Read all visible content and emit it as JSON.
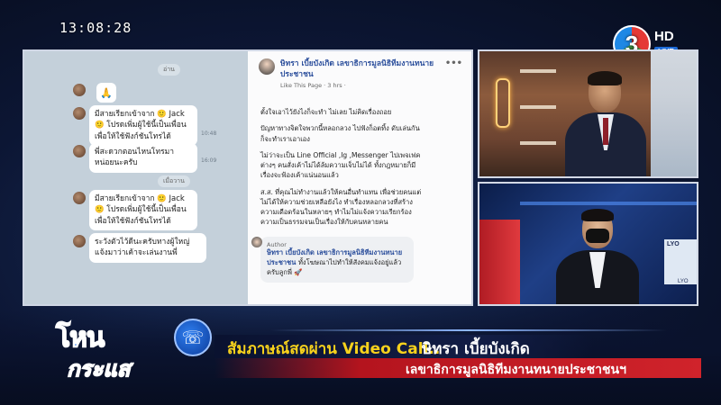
{
  "clock": "13:08:28",
  "channel": {
    "number": "3",
    "hd": "HD",
    "live": "LIVE"
  },
  "chat": {
    "top_label": "อ่าน",
    "separator": "เมื่อวาน",
    "messages": [
      {
        "text": "🙏",
        "time": ""
      },
      {
        "text": "มีสายเรียกเข้าจาก 🙂 Jack 🙂 โปรดเพิ่มผู้ใช้นี้เป็นเพื่อนเพื่อให้ใช้ฟังก์ชันโทรได้",
        "time": "10:48"
      },
      {
        "text": "พี่สะดวกตอนไหนโทรมาหน่อยนะครับ",
        "time": "16:09"
      },
      {
        "text": "มีสายเรียกเข้าจาก 🙂 Jack 🙂 โปรดเพิ่มผู้ใช้นี้เป็นเพื่อนเพื่อให้ใช้ฟังก์ชันโทรได้",
        "time": ""
      },
      {
        "text": "ระวังตัวไว้ดีนะครับทางผู้ใหญ่แจ้งมาว่าเค้าจะเล่นงานพี่",
        "time": ""
      }
    ]
  },
  "facebook": {
    "page_title": "ษิทรา เบี้ยบังเกิด เลขาธิการมูลนิธิทีมงานทนายประชาชน",
    "meta": "Like This Page · 3 hrs ·",
    "body": [
      "ตั้งใจเอาไว้ยังไงก็จะทำ ไม่เลย ไม่คิดเรื่องถอย",
      "ปัญหาทางจิตใจพวกนี้หลอกลวง ไปฟังก็อตทิ้ง ดับเล่นกันก็จะทำเราเอาเอง",
      "ไม่ว่าจะเป็น Line Official ,Ig ,Messenger ไปเพจเฟคต่างๆ คนสั่งเค้าไม่ได้ล้มความเจ็บไม่ได้ ทั้งกฎหมายก็มีเรื่องจะฟ้องเค้าแน่นอนแล้ว",
      "ส.ส. ที่คุณไม่ทำงานแล้วให้คนอื่นทำแทน เพื่อช่วยคนแต่ไม่ได้ให้ความช่วยเหลือยังไง ทำเรื่องหลอกลวงที่สร้างความเดือดร้อนในหลายๆ ทำไมไม่แจ้งความเรียกร้องความเป็นธรรมจนเป็นเรื่องให้กับคนหลายคน"
    ],
    "comment_author": "Author",
    "comment_name": "ษิทรา เบี้ยบังเกิด เลขาธิการมูลนิธิทีมงานทนายประชาชน",
    "comment_text": "ทั้งโฆษณาไปทำให้สังคมแจ้งอยู่แล้วครับลูกพี่ 🚀"
  },
  "video2": {
    "screen_label": "LYO",
    "screen_sub": "LYO"
  },
  "lower_third": {
    "show_line1": "โหน",
    "show_line2": "กระแส",
    "phone_icon": "☏",
    "headline": "สัมภาษณ์สดผ่าน Video Call..",
    "headline_name": "ษิทรา   เบี้ยบังเกิด",
    "subline": "เลขาธิการมูลนิธิทีมงานทนายประชาชนฯ"
  },
  "colors": {
    "headline": "#f7d21c",
    "accent_red": "#d0232b",
    "accent_blue": "#1f6fe8"
  }
}
